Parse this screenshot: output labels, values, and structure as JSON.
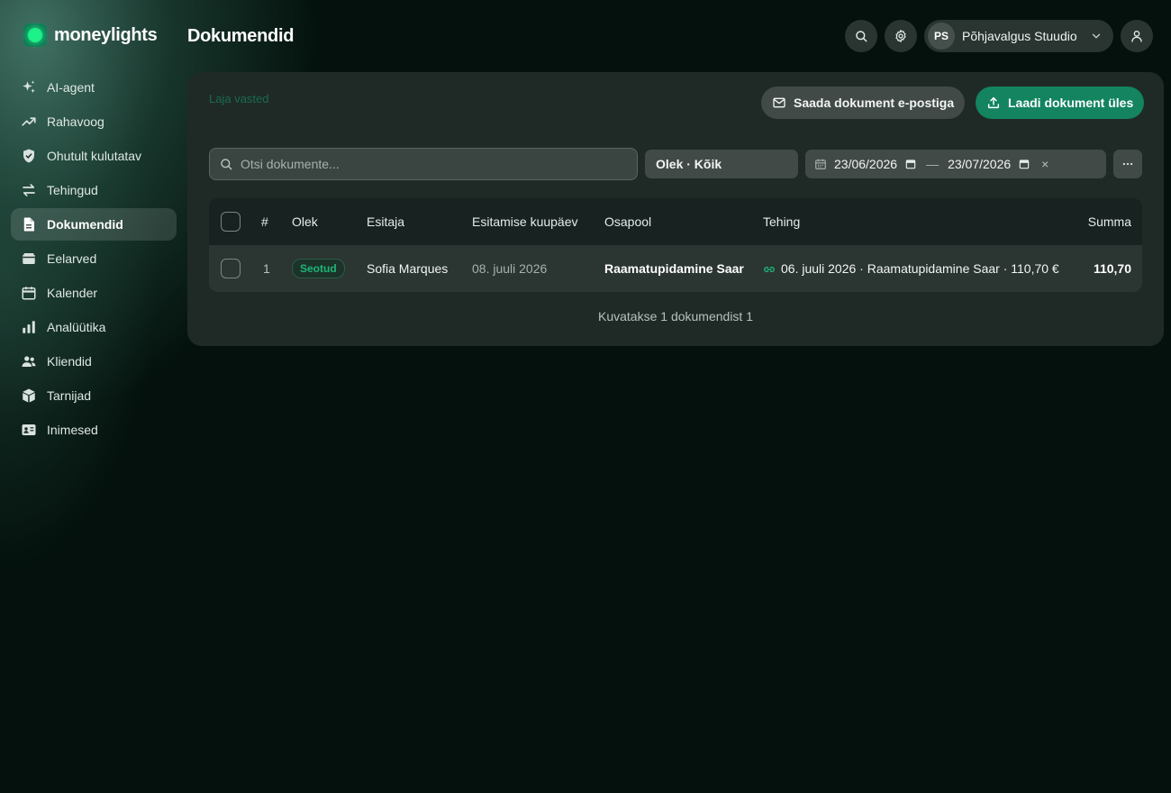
{
  "app": {
    "brand": "moneylights",
    "page_title": "Dokumendid"
  },
  "colors": {
    "accent": "#13845f",
    "badge_green": "#1fb579",
    "background": "#04110d"
  },
  "sidebar": {
    "items": [
      {
        "label": "AI-agent",
        "icon": "sparkles-icon"
      },
      {
        "label": "Rahavoog",
        "icon": "trend-up-icon"
      },
      {
        "label": "Ohutult kulutatav",
        "icon": "shield-check-icon"
      },
      {
        "label": "Tehingud",
        "icon": "arrows-exchange-icon"
      },
      {
        "label": "Dokumendid",
        "icon": "document-icon",
        "active": true
      },
      {
        "label": "Eelarved",
        "icon": "wallet-icon"
      },
      {
        "label": "Kalender",
        "icon": "calendar-icon"
      },
      {
        "label": "Analüütika",
        "icon": "bar-chart-icon"
      },
      {
        "label": "Kliendid",
        "icon": "users-icon"
      },
      {
        "label": "Tarnijad",
        "icon": "box-icon"
      },
      {
        "label": "Inimesed",
        "icon": "id-card-icon"
      }
    ]
  },
  "header": {
    "org_initials": "PS",
    "org_name": "Põhjavalgus Stuudio"
  },
  "toolbar": {
    "hint": "Laja vasted",
    "email_button": "Saada dokument e-postiga",
    "upload_button": "Laadi dokument üles",
    "search_placeholder": "Otsi dokumente...",
    "status_filter": "Olek · Kõik",
    "date_from": "23/06/2026",
    "date_to": "23/07/2026",
    "date_separator": "—",
    "clear": "×"
  },
  "table": {
    "headers": {
      "index": "#",
      "status": "Olek",
      "submitter": "Esitaja",
      "submitted_date": "Esitamise kuupäev",
      "counterparty": "Osapool",
      "transaction": "Tehing",
      "amount": "Summa"
    },
    "rows": [
      {
        "index": "1",
        "status": "Seotud",
        "submitter": "Sofia Marques",
        "submitted_date": "08. juuli 2026",
        "counterparty": "Raamatupidamine Saar",
        "transaction": "06. juuli 2026 · Raamatupidamine Saar · 110,70 €",
        "amount": "110,70"
      }
    ],
    "footer": "Kuvatakse 1 dokumendist 1"
  }
}
